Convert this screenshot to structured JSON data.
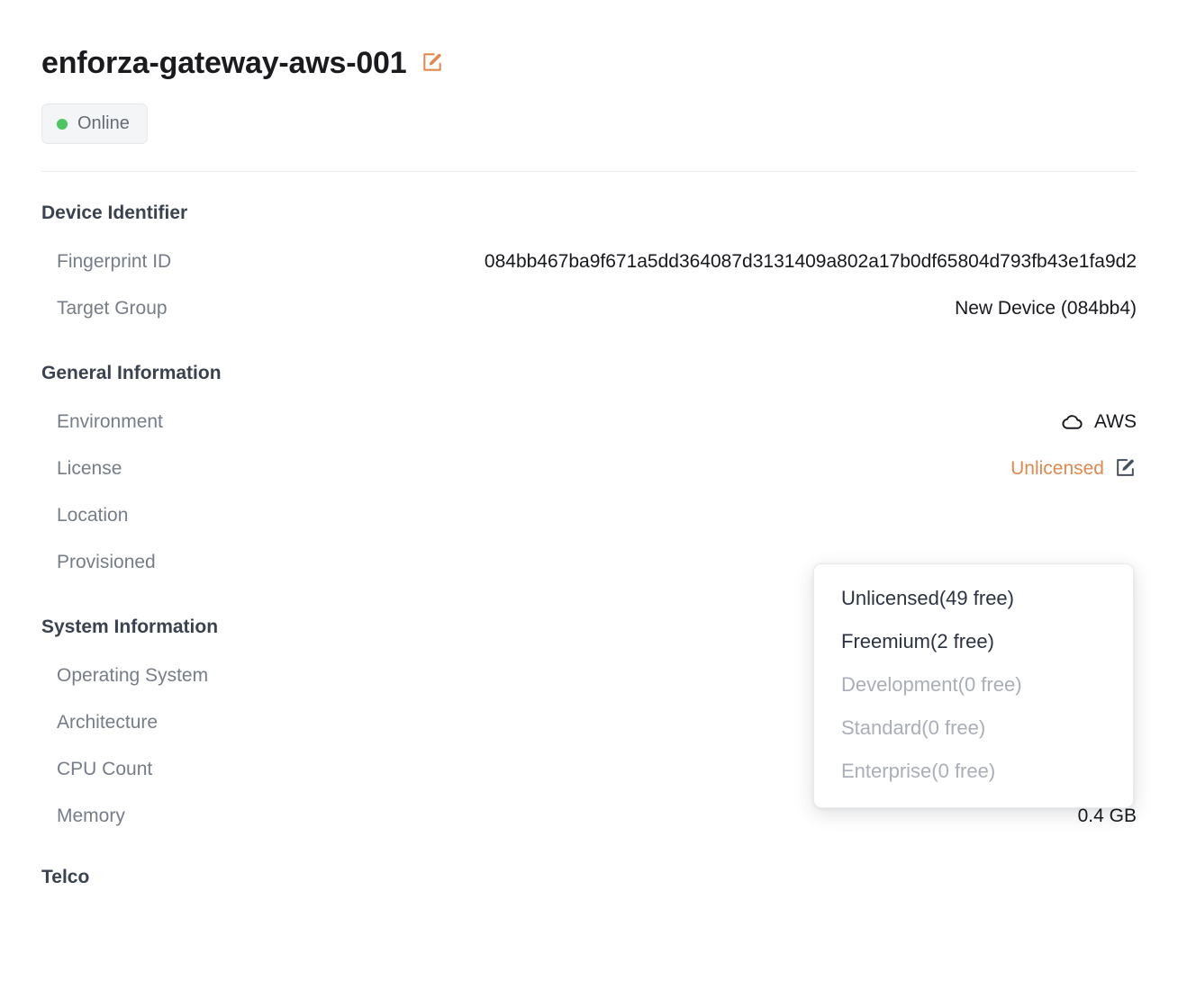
{
  "header": {
    "title": "enforza-gateway-aws-001",
    "edit_icon": "edit-pencil-icon",
    "status": {
      "label": "Online",
      "dot_color": "#4cc662"
    }
  },
  "sections": [
    {
      "title": "Device Identifier",
      "rows": [
        {
          "label": "Fingerprint ID",
          "value": "084bb467ba9f671a5dd364087d3131409a802a17b0df65804d793fb43e1fa9d2"
        },
        {
          "label": "Target Group",
          "value": "New Device (084bb4)"
        }
      ]
    },
    {
      "title": "General Information",
      "rows": [
        {
          "label": "Environment",
          "value": "AWS",
          "icon": "cloud-icon"
        },
        {
          "label": "License",
          "value": "Unlicensed",
          "icon": "edit-pencil-icon"
        },
        {
          "label": "Location",
          "value": ""
        },
        {
          "label": "Provisioned",
          "value": ""
        }
      ]
    },
    {
      "title": "System Information",
      "rows": [
        {
          "label": "Operating System",
          "value": ""
        },
        {
          "label": "Architecture",
          "value": ""
        },
        {
          "label": "CPU Count",
          "value": ""
        },
        {
          "label": "Memory",
          "value": "0.4 GB"
        }
      ]
    },
    {
      "title": "Telco",
      "rows": []
    }
  ],
  "license_dropdown": {
    "options": [
      {
        "label": "Unlicensed(49 free)",
        "disabled": false
      },
      {
        "label": "Freemium(2 free)",
        "disabled": false
      },
      {
        "label": "Development(0 free)",
        "disabled": true
      },
      {
        "label": "Standard(0 free)",
        "disabled": true
      },
      {
        "label": "Enterprise(0 free)",
        "disabled": true
      }
    ]
  },
  "colors": {
    "accent_orange": "#e0884e",
    "status_green": "#4cc662",
    "label_gray": "#767d88",
    "heading": "#3a4250"
  }
}
